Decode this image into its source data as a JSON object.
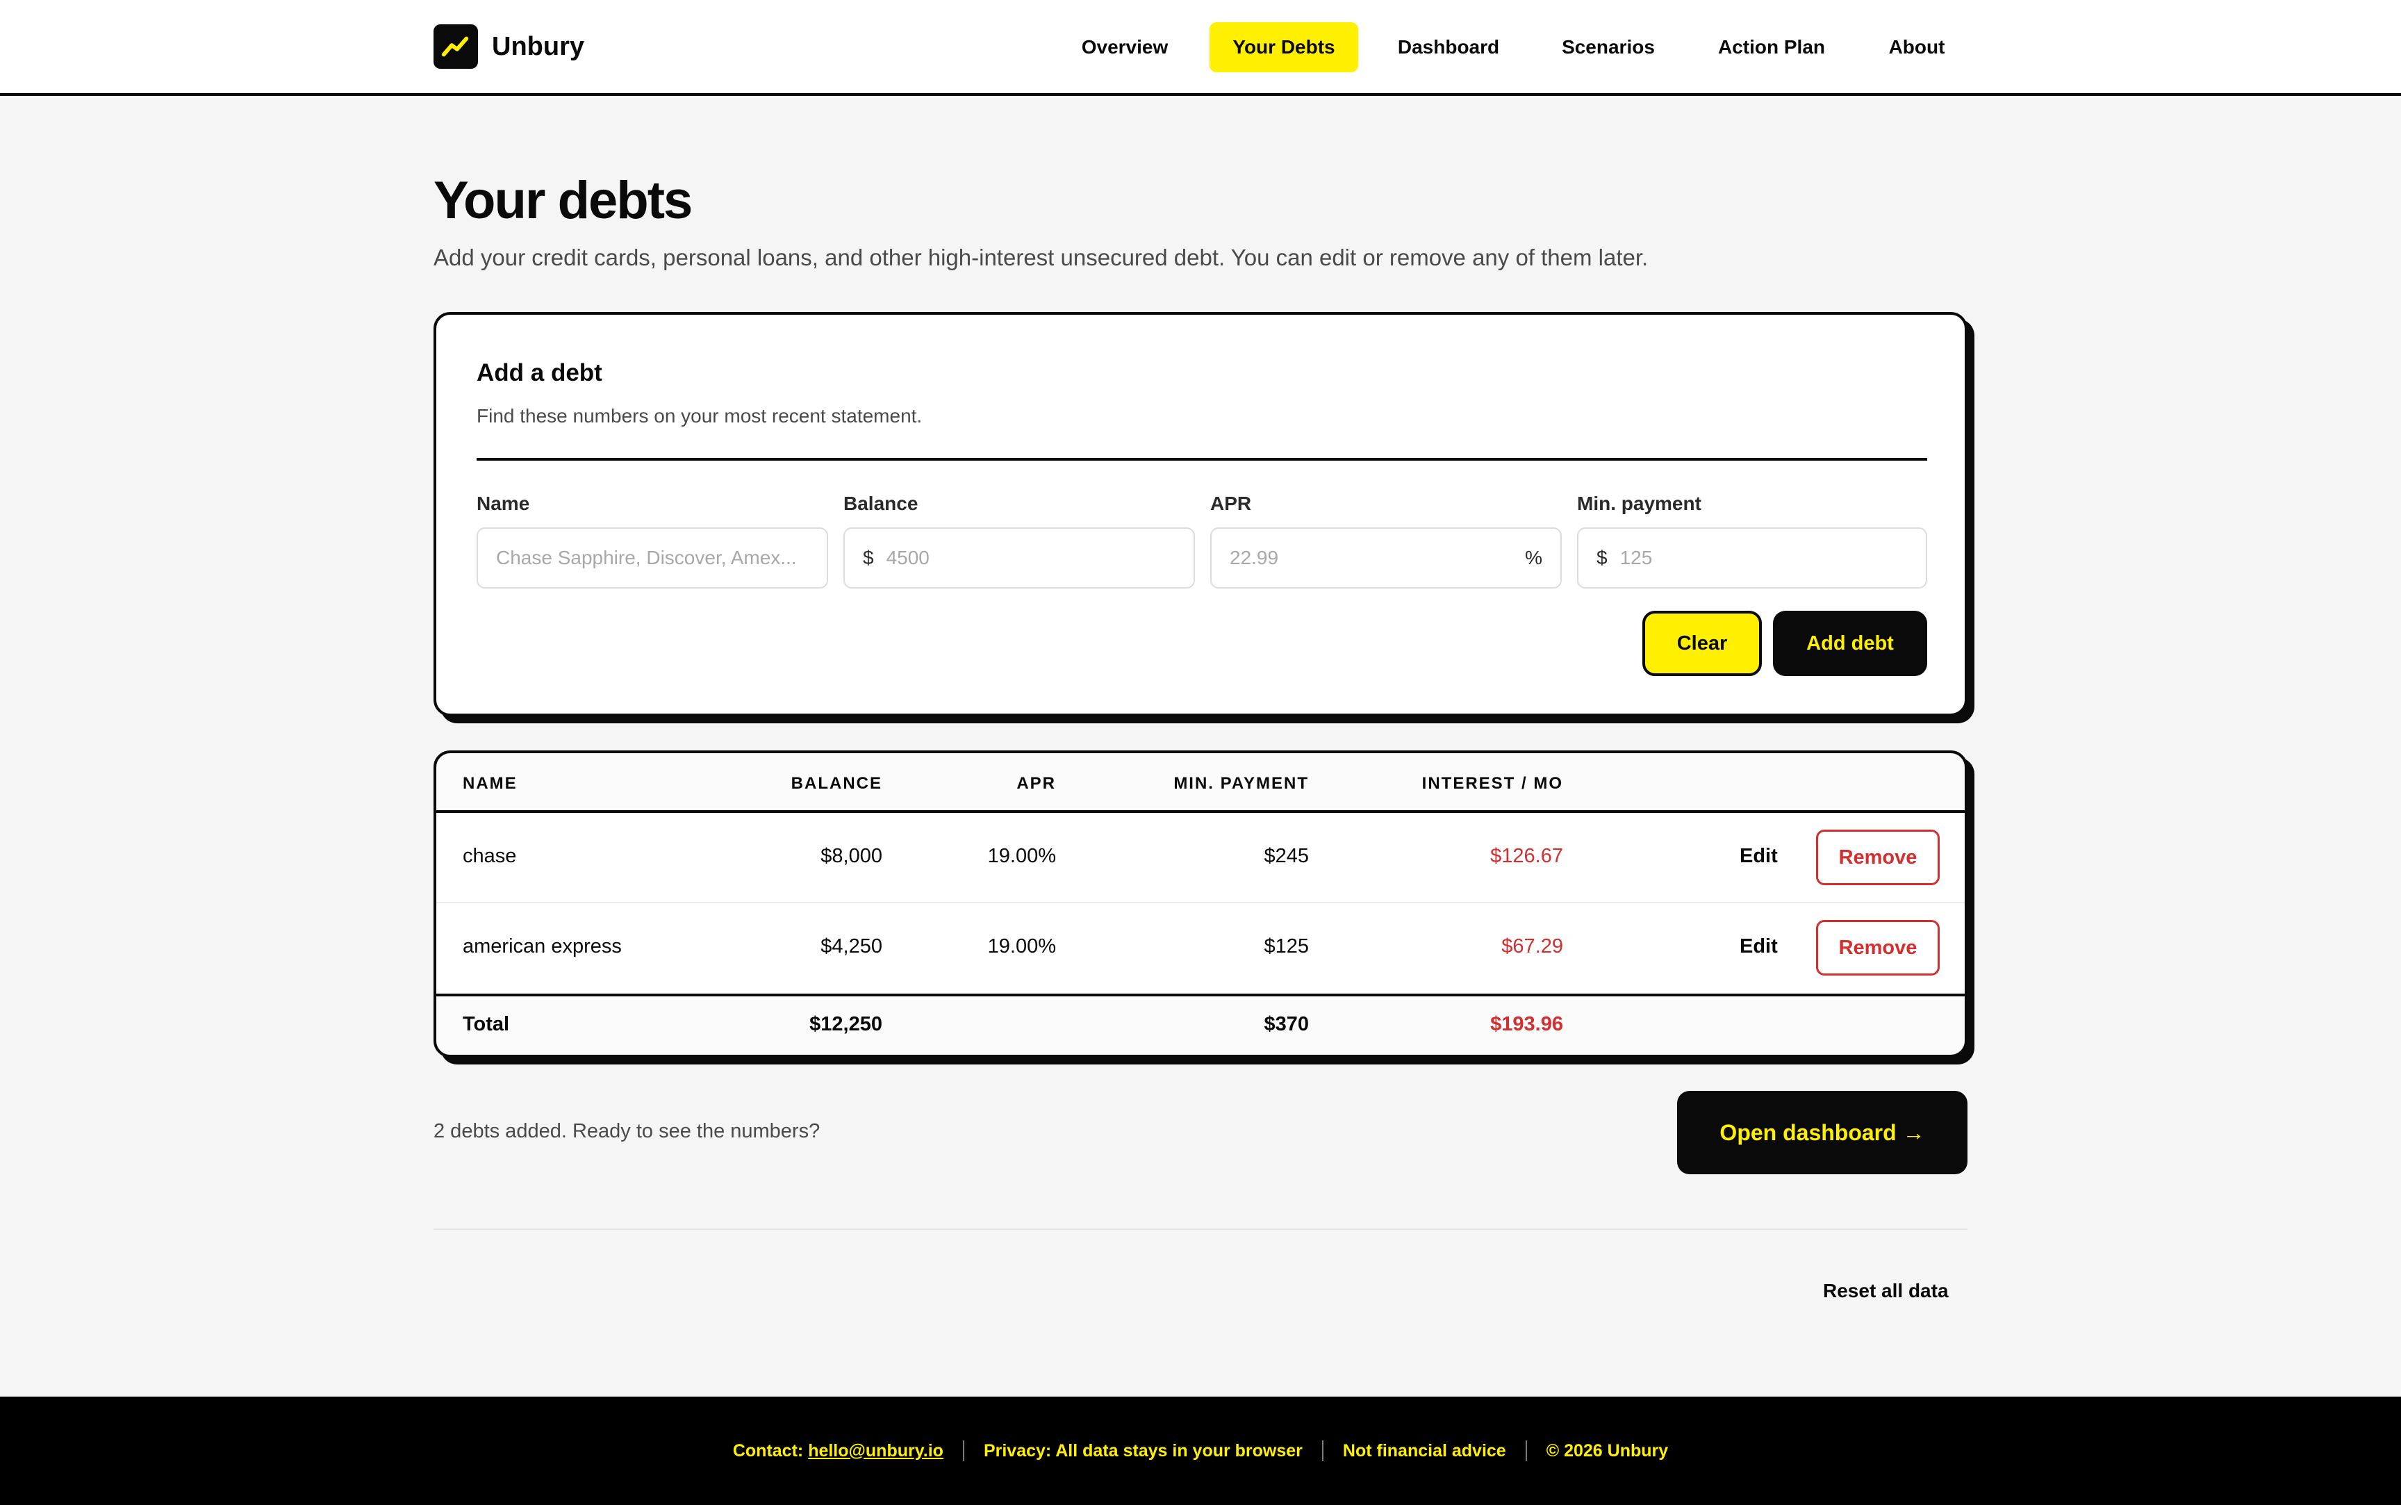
{
  "brand": {
    "name": "Unbury",
    "logo_icon": "trending-up-icon",
    "accent": "#ffef00"
  },
  "nav": {
    "items": [
      {
        "label": "Overview",
        "active": false
      },
      {
        "label": "Your Debts",
        "active": true
      },
      {
        "label": "Dashboard",
        "active": false
      },
      {
        "label": "Scenarios",
        "active": false
      },
      {
        "label": "Action Plan",
        "active": false
      },
      {
        "label": "About",
        "active": false
      }
    ]
  },
  "page": {
    "title": "Your debts",
    "subtitle": "Add your credit cards, personal loans, and other high-interest unsecured debt. You can edit or remove any of them later."
  },
  "form": {
    "title": "Add a debt",
    "subtitle": "Find these numbers on your most recent statement.",
    "fields": {
      "name": {
        "label": "Name",
        "placeholder": "Chase Sapphire, Discover, Amex...",
        "value": ""
      },
      "balance": {
        "label": "Balance",
        "prefix": "$",
        "placeholder": "4500",
        "value": ""
      },
      "apr": {
        "label": "APR",
        "suffix": "%",
        "placeholder": "22.99",
        "value": ""
      },
      "min_payment": {
        "label": "Min. payment",
        "prefix": "$",
        "placeholder": "125",
        "value": ""
      }
    },
    "clear_label": "Clear",
    "add_label": "Add debt"
  },
  "table": {
    "headers": {
      "name": "NAME",
      "balance": "BALANCE",
      "apr": "APR",
      "min_payment": "MIN. PAYMENT",
      "interest": "INTEREST / MO"
    },
    "rows": [
      {
        "name": "chase",
        "balance": "$8,000",
        "apr": "19.00%",
        "min_payment": "$245",
        "interest": "$126.67",
        "edit": "Edit",
        "remove": "Remove"
      },
      {
        "name": "american express",
        "balance": "$4,250",
        "apr": "19.00%",
        "min_payment": "$125",
        "interest": "$67.29",
        "edit": "Edit",
        "remove": "Remove"
      }
    ],
    "total": {
      "label": "Total",
      "balance": "$12,250",
      "min_payment": "$370",
      "interest": "$193.96"
    }
  },
  "status": {
    "text": "2 debts added. Ready to see the numbers?",
    "open_label": "Open dashboard →"
  },
  "reset_label": "Reset all data",
  "footer": {
    "contact_label": "Contact:",
    "email": "hello@unbury.io",
    "privacy": "Privacy: All data stays in your browser",
    "disclaimer": "Not financial advice",
    "copyright": "© 2026 Unbury"
  },
  "colors": {
    "negative": "#d32f2f",
    "ink": "#0a0a0a",
    "background": "#f5f5f5"
  }
}
